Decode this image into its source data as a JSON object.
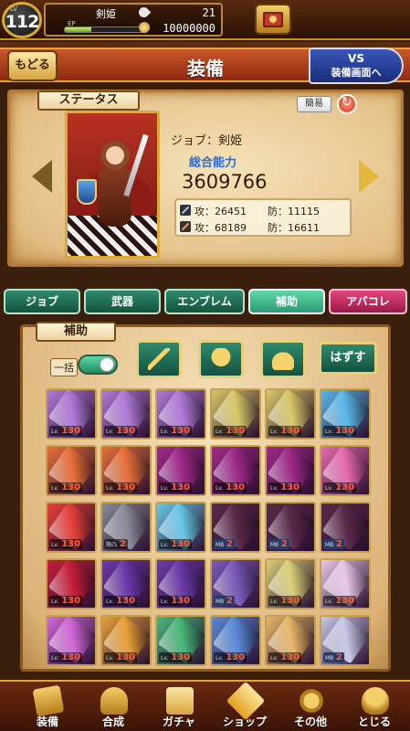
{
  "topbar": {
    "level_label": "LV",
    "level": "112",
    "player_name": "剣姫",
    "exp_label": "EP",
    "exp_fraction": 0.32,
    "stamina": "21",
    "gold": "10000000"
  },
  "header": {
    "back_label": "もどる",
    "title": "装備",
    "vs_line1": "VS",
    "vs_line2": "装備画面へ"
  },
  "status": {
    "section_label": "ステータス",
    "easy_label": "簡易",
    "job_text": "ジョブ：剣姫",
    "power_label": "総合能力",
    "power_value": "3609766",
    "physical": {
      "atk": "攻：26451",
      "def": "防：11115"
    },
    "magic": {
      "atk": "攻：68189",
      "def": "防：16611"
    }
  },
  "tabs": [
    {
      "label": "ジョブ",
      "active": false
    },
    {
      "label": "武器",
      "active": false
    },
    {
      "label": "エンブレム",
      "active": false
    },
    {
      "label": "補助",
      "active": true
    },
    {
      "label": "アバコレ",
      "active": false
    }
  ],
  "support": {
    "section_label": "補助",
    "bulk_label": "一括",
    "bulk_on": true,
    "remove_label": "はずす",
    "filter_icons": [
      "sword-icon",
      "armor-icon",
      "helmet-icon"
    ]
  },
  "items": [
    {
      "badge": "lv",
      "lv_prefix": "Lv.",
      "value": "130",
      "color": "#b07ad8"
    },
    {
      "badge": "lv",
      "lv_prefix": "Lv.",
      "value": "130",
      "color": "#b07ad8"
    },
    {
      "badge": "lv",
      "lv_prefix": "Lv.",
      "value": "130",
      "color": "#b07ad8"
    },
    {
      "badge": "lv",
      "lv_prefix": "Lv.",
      "value": "130",
      "color": "#d8c86a"
    },
    {
      "badge": "lv",
      "lv_prefix": "Lv.",
      "value": "130",
      "color": "#d8c86a"
    },
    {
      "badge": "lv",
      "lv_prefix": "Lv.",
      "value": "130",
      "color": "#5ab8e8"
    },
    {
      "badge": "lv",
      "lv_prefix": "Lv.",
      "value": "130",
      "color": "#e8703a"
    },
    {
      "badge": "lv",
      "lv_prefix": "Lv.",
      "value": "130",
      "color": "#e8703a"
    },
    {
      "badge": "lv",
      "lv_prefix": "Lv.",
      "value": "130",
      "color": "#a02a8a"
    },
    {
      "badge": "lv",
      "lv_prefix": "Lv.",
      "value": "130",
      "color": "#a02a8a"
    },
    {
      "badge": "lv",
      "lv_prefix": "Lv.",
      "value": "130",
      "color": "#a02a8a"
    },
    {
      "badge": "lv",
      "lv_prefix": "Lv.",
      "value": "130",
      "color": "#e86ab0"
    },
    {
      "badge": "lv",
      "lv_prefix": "Lv.",
      "value": "130",
      "color": "#e8403a"
    },
    {
      "badge": "lv",
      "lv_prefix": "限凸",
      "value": "2",
      "color": "#8a8a9a"
    },
    {
      "badge": "lv",
      "lv_prefix": "Lv.",
      "value": "130",
      "color": "#6ac8e8"
    },
    {
      "badge": "mb",
      "lv_prefix": "MB",
      "value": "2",
      "color": "#5a2a4a"
    },
    {
      "badge": "mb",
      "lv_prefix": "MB",
      "value": "2",
      "color": "#5a2a4a"
    },
    {
      "badge": "mb",
      "lv_prefix": "MB",
      "value": "2",
      "color": "#5a2a4a"
    },
    {
      "badge": "lv",
      "lv_prefix": "Lv.",
      "value": "130",
      "color": "#c81e3a"
    },
    {
      "badge": "lv",
      "lv_prefix": "Lv.",
      "value": "130",
      "color": "#6a3aa8"
    },
    {
      "badge": "lv",
      "lv_prefix": "Lv.",
      "value": "130",
      "color": "#6a3aa8"
    },
    {
      "badge": "mb",
      "lv_prefix": "MB",
      "value": "2",
      "color": "#7a5ab8"
    },
    {
      "badge": "lv",
      "lv_prefix": "Lv.",
      "value": "130",
      "color": "#d8d07a"
    },
    {
      "badge": "lv",
      "lv_prefix": "Lv.",
      "value": "130",
      "color": "#e8c8e8"
    },
    {
      "badge": "lv",
      "lv_prefix": "Lv.",
      "value": "130",
      "color": "#d06ad8"
    },
    {
      "badge": "lv",
      "lv_prefix": "Lv.",
      "value": "130",
      "color": "#e8a03a"
    },
    {
      "badge": "lv",
      "lv_prefix": "Lv.",
      "value": "130",
      "color": "#4ab87a"
    },
    {
      "badge": "lv",
      "lv_prefix": "Lv.",
      "value": "130",
      "color": "#5a8ad8"
    },
    {
      "badge": "lv",
      "lv_prefix": "Lv.",
      "value": "130",
      "color": "#e8b86a"
    },
    {
      "badge": "mb",
      "lv_prefix": "MB",
      "value": "2",
      "color": "#c8c8e8"
    }
  ],
  "bottom_nav": [
    {
      "label": "装備",
      "icon": "equip-icon"
    },
    {
      "label": "合成",
      "icon": "hammer-icon"
    },
    {
      "label": "ガチャ",
      "icon": "gacha-icon"
    },
    {
      "label": "ショップ",
      "icon": "crystal-icon"
    },
    {
      "label": "その他",
      "icon": "gear-icon"
    },
    {
      "label": "とじる",
      "icon": "close-icon"
    }
  ]
}
